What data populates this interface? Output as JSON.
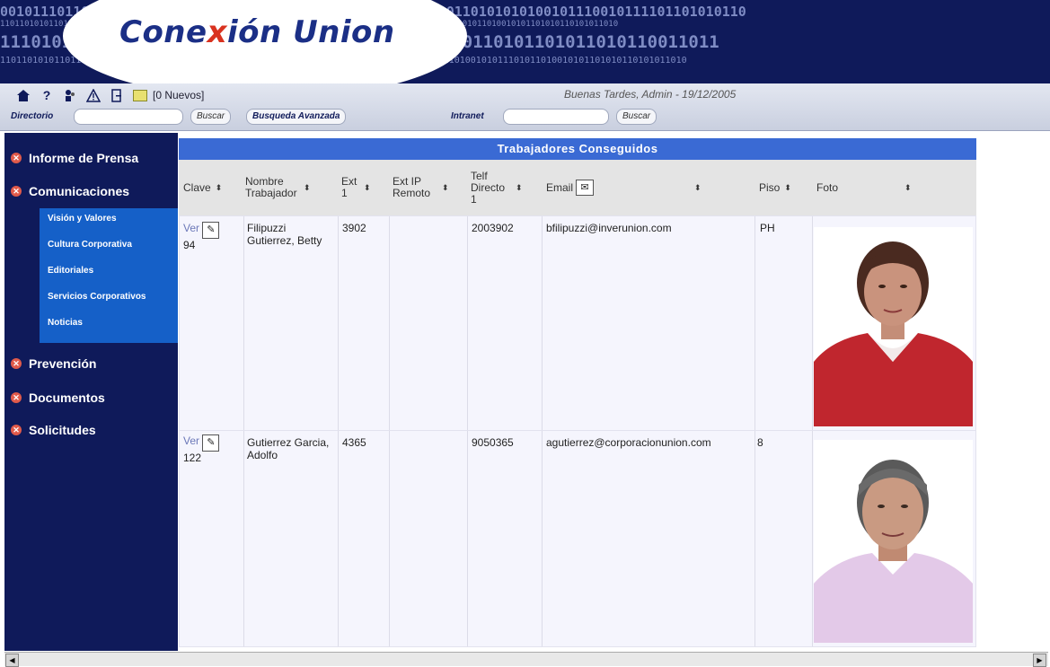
{
  "banner": {
    "logo_part1": "Cone",
    "logo_x": "x",
    "logo_part2": "ión Union"
  },
  "toolbar": {
    "icons": [
      "home-icon",
      "help-icon",
      "users-icon",
      "warning-icon",
      "exit-icon",
      "mail-icon"
    ],
    "new_messages": "[0 Nuevos]",
    "greeting": "Buenas Tardes, Admin - 19/12/2005",
    "directorio_label": "Directorio",
    "directorio_value": "",
    "buscar1": "Buscar",
    "busqueda_avanzada": "Busqueda Avanzada",
    "intranet_label": "Intranet",
    "intranet_value": "",
    "buscar2": "Buscar"
  },
  "sidebar": {
    "items": [
      {
        "label": "Informe de Prensa"
      },
      {
        "label": "Comunicaciones"
      },
      {
        "label": "Prevención"
      },
      {
        "label": "Documentos"
      },
      {
        "label": "Solicitudes"
      }
    ],
    "submenu": [
      {
        "label": "Visión y Valores"
      },
      {
        "label": "Cultura Corporativa"
      },
      {
        "label": "Editoriales"
      },
      {
        "label": "Servicios Corporativos"
      },
      {
        "label": "Noticias"
      }
    ]
  },
  "table": {
    "caption": "Trabajadores Conseguidos",
    "columns": [
      {
        "label": "Clave"
      },
      {
        "label": "Nombre Trabajador"
      },
      {
        "label": "Ext 1"
      },
      {
        "label": "Ext IP Remoto"
      },
      {
        "label": "Telf Directo 1"
      },
      {
        "label": "Email"
      },
      {
        "label": "Piso"
      },
      {
        "label": "Foto"
      }
    ],
    "rows": [
      {
        "ver": "Ver",
        "clave": "94",
        "nombre": "Filipuzzi Gutierrez, Betty",
        "ext1": "3902",
        "ext_ip": "",
        "telf": "2003902",
        "email": "bfilipuzzi@inverunion.com",
        "piso": "PH",
        "foto": "photo-woman"
      },
      {
        "ver": "Ver",
        "clave": "122",
        "nombre": "Gutierrez Garcia, Adolfo",
        "ext1": "4365",
        "ext_ip": "",
        "telf": "9050365",
        "email": "agutierrez@corporacionunion.com",
        "piso": "8",
        "foto": "photo-man"
      }
    ]
  },
  "colors": {
    "navy": "#0f1a5a",
    "submenu_blue": "#1560c8",
    "caption_blue": "#3a6ad4",
    "accent_red": "#d9321f"
  }
}
